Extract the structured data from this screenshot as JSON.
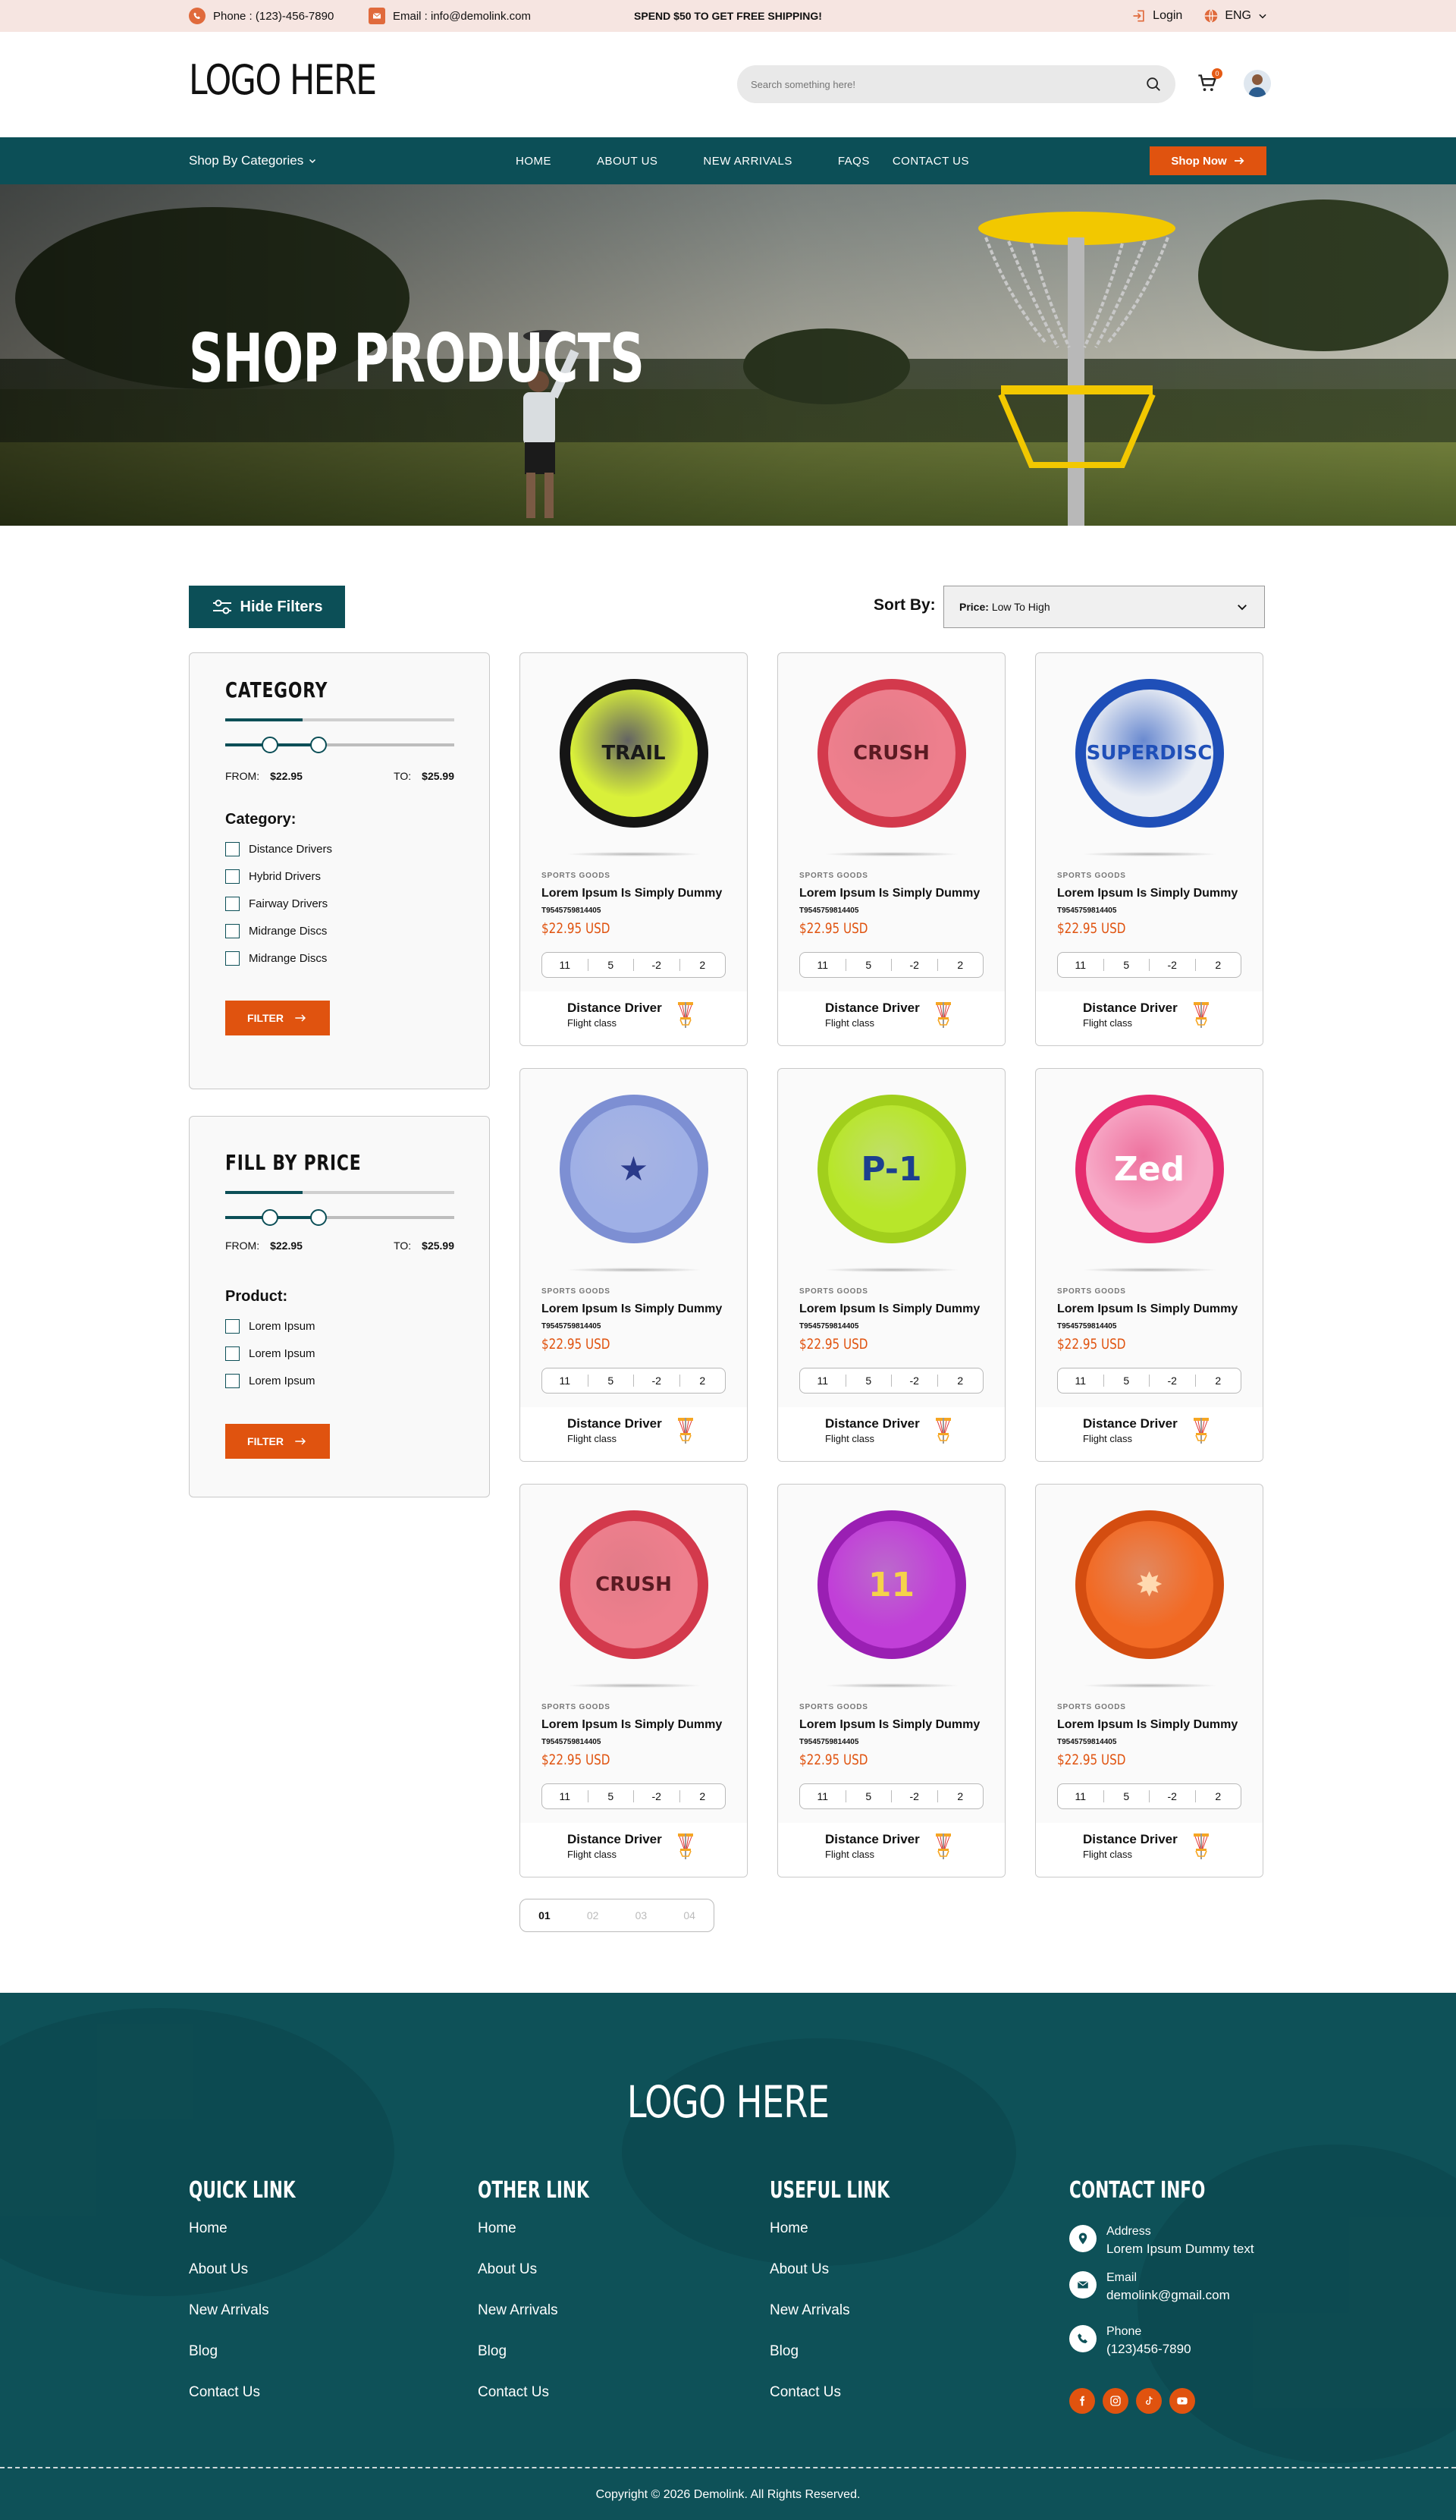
{
  "topbar": {
    "phone": "Phone : (123)-456-7890",
    "email": "Email : info@demolink.com",
    "promo": "SPEND $50 TO GET FREE SHIPPING!",
    "login": "Login",
    "language": "ENG"
  },
  "header": {
    "logo": "LOGO HERE",
    "search_placeholder": "Search something here!",
    "cart_count": "0"
  },
  "nav": {
    "categories": "Shop By Categories",
    "links": [
      "HOME",
      "ABOUT US",
      "NEW ARRIVALS",
      "FAQS",
      "CONTACT US"
    ],
    "shop_now": "Shop Now"
  },
  "hero": {
    "title": "SHOP PRODUCTS"
  },
  "controls": {
    "hide_filters": "Hide Filters",
    "sort_label": "Sort By:",
    "sort_key": "Price:",
    "sort_value": "Low To High"
  },
  "category_panel": {
    "title": "CATEGORY",
    "from_label": "FROM:",
    "from_value": "$22.95",
    "to_label": "TO:",
    "to_value": "$25.99",
    "subhead": "Category:",
    "options": [
      "Distance Drivers",
      "Hybrid Drivers",
      "Fairway Drivers",
      "Midrange Discs",
      "Midrange Discs"
    ],
    "filter_button": "FILTER"
  },
  "price_panel": {
    "title": "FILL BY PRICE",
    "from_label": "FROM:",
    "from_value": "$22.95",
    "to_label": "TO:",
    "to_value": "$25.99",
    "subhead": "Product:",
    "options": [
      "Lorem Ipsum",
      "Lorem Ipsum",
      "Lorem Ipsum"
    ],
    "filter_button": "FILTER"
  },
  "products": [
    {
      "category": "SPORTS GOODS",
      "title": "Lorem Ipsum Is Simply Dummy",
      "sku": "T9545759814405",
      "price": "$22.95 USD",
      "stats": [
        "11",
        "5",
        "-2",
        "2"
      ],
      "foot_title": "Distance Driver",
      "foot_sub": "Flight class",
      "disc_text": "TRAIL",
      "disc_color": "#d9f03a",
      "rim_color": "#151515",
      "text_color": "#1a1a1a"
    },
    {
      "category": "SPORTS GOODS",
      "title": "Lorem Ipsum Is Simply Dummy",
      "sku": "T9545759814405",
      "price": "$22.95 USD",
      "stats": [
        "11",
        "5",
        "-2",
        "2"
      ],
      "foot_title": "Distance Driver",
      "foot_sub": "Flight class",
      "disc_text": "CRUSH",
      "disc_color": "#ee7f8d",
      "rim_color": "#d3394c",
      "text_color": "#5a1a22"
    },
    {
      "category": "SPORTS GOODS",
      "title": "Lorem Ipsum Is Simply Dummy",
      "sku": "T9545759814405",
      "price": "$22.95 USD",
      "stats": [
        "11",
        "5",
        "-2",
        "2"
      ],
      "foot_title": "Distance Driver",
      "foot_sub": "Flight class",
      "disc_text": "SUPERDISC",
      "disc_color": "#e9edf4",
      "rim_color": "#1f4fb8",
      "text_color": "#1f4fb8"
    },
    {
      "category": "SPORTS GOODS",
      "title": "Lorem Ipsum Is Simply Dummy",
      "sku": "T9545759814405",
      "price": "$22.95 USD",
      "stats": [
        "11",
        "5",
        "-2",
        "2"
      ],
      "foot_title": "Distance Driver",
      "foot_sub": "Flight class",
      "disc_text": "★",
      "disc_color": "#9fb0e6",
      "rim_color": "#7d8fd3",
      "text_color": "#2a3a8a"
    },
    {
      "category": "SPORTS GOODS",
      "title": "Lorem Ipsum Is Simply Dummy",
      "sku": "T9545759814405",
      "price": "$22.95 USD",
      "stats": [
        "11",
        "5",
        "-2",
        "2"
      ],
      "foot_title": "Distance Driver",
      "foot_sub": "Flight class",
      "disc_text": "P-1",
      "disc_color": "#b8e62a",
      "rim_color": "#a1cf1c",
      "text_color": "#1c3f8e"
    },
    {
      "category": "SPORTS GOODS",
      "title": "Lorem Ipsum Is Simply Dummy",
      "sku": "T9545759814405",
      "price": "$22.95 USD",
      "stats": [
        "11",
        "5",
        "-2",
        "2"
      ],
      "foot_title": "Distance Driver",
      "foot_sub": "Flight class",
      "disc_text": "Zed",
      "disc_color": "#f7a8c6",
      "rim_color": "#e52b6e",
      "text_color": "#ffffff"
    },
    {
      "category": "SPORTS GOODS",
      "title": "Lorem Ipsum Is Simply Dummy",
      "sku": "T9545759814405",
      "price": "$22.95 USD",
      "stats": [
        "11",
        "5",
        "-2",
        "2"
      ],
      "foot_title": "Distance Driver",
      "foot_sub": "Flight class",
      "disc_text": "CRUSH",
      "disc_color": "#ee7f8d",
      "rim_color": "#d3394c",
      "text_color": "#5a1a22"
    },
    {
      "category": "SPORTS GOODS",
      "title": "Lorem Ipsum Is Simply Dummy",
      "sku": "T9545759814405",
      "price": "$22.95 USD",
      "stats": [
        "11",
        "5",
        "-2",
        "2"
      ],
      "foot_title": "Distance Driver",
      "foot_sub": "Flight class",
      "disc_text": "11",
      "disc_color": "#c13fd8",
      "rim_color": "#9a1fb3",
      "text_color": "#f5d24a"
    },
    {
      "category": "SPORTS GOODS",
      "title": "Lorem Ipsum Is Simply Dummy",
      "sku": "T9545759814405",
      "price": "$22.95 USD",
      "stats": [
        "11",
        "5",
        "-2",
        "2"
      ],
      "foot_title": "Distance Driver",
      "foot_sub": "Flight class",
      "disc_text": "✸",
      "disc_color": "#f26a24",
      "rim_color": "#d44d10",
      "text_color": "#ffd9b0"
    }
  ],
  "pagination": [
    "01",
    "02",
    "03",
    "04"
  ],
  "footer": {
    "logo": "LOGO HERE",
    "columns": [
      {
        "title": "QUICK LINK",
        "links": [
          "Home",
          "About Us",
          "New Arrivals",
          "Blog",
          "Contact Us"
        ]
      },
      {
        "title": "OTHER LINK",
        "links": [
          "Home",
          "About Us",
          "New Arrivals",
          "Blog",
          "Contact Us"
        ]
      },
      {
        "title": "USEFUL LINK",
        "links": [
          "Home",
          "About Us",
          "New Arrivals",
          "Blog",
          "Contact Us"
        ]
      }
    ],
    "contact": {
      "title": "CONTACT INFO",
      "address_label": "Address",
      "address_value": "Lorem Ipsum Dummy text",
      "email_label": "Email",
      "email_value": "demolink@gmail.com",
      "phone_label": "Phone",
      "phone_value": "(123)456-7890"
    },
    "social": [
      "facebook-icon",
      "instagram-icon",
      "tiktok-icon",
      "youtube-icon"
    ],
    "copyright": "Copyright © 2026 Demolink. All Rights Reserved."
  },
  "colors": {
    "teal": "#0c4f57",
    "orange": "#e0530f",
    "topbar": "#f6e5e1"
  }
}
